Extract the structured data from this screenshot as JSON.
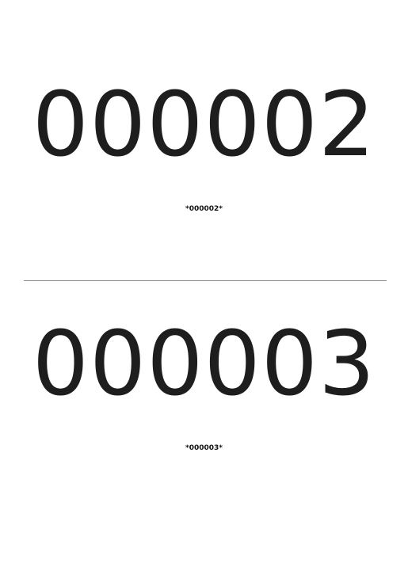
{
  "labels": [
    {
      "number": "000002",
      "barcode_text": "*000002*"
    },
    {
      "number": "000003",
      "barcode_text": "*000003*"
    }
  ]
}
